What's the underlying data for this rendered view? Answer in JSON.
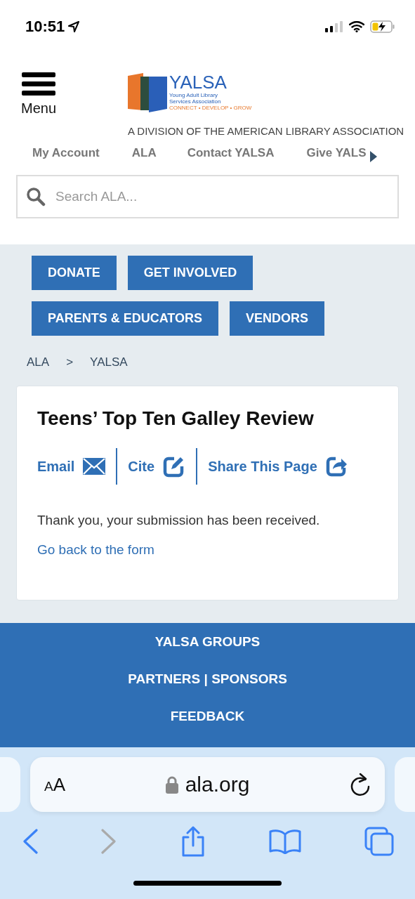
{
  "status_bar": {
    "time": "10:51"
  },
  "header": {
    "menu_label": "Menu",
    "logo": {
      "name": "YALSA",
      "subtitle": "Young Adult Library Services Association",
      "tagline": "CONNECT • DEVELOP • GROW"
    },
    "division": "A DIVISION OF THE AMERICAN LIBRARY ASSOCIATION",
    "nav": [
      "My Account",
      "ALA",
      "Contact YALSA",
      "Give YALS"
    ],
    "search": {
      "placeholder": "Search ALA..."
    }
  },
  "action_buttons": [
    "DONATE",
    "GET INVOLVED",
    "PARENTS & EDUCATORS",
    "VENDORS"
  ],
  "breadcrumb": {
    "items": [
      "ALA",
      "YALSA"
    ],
    "separator": ">"
  },
  "card": {
    "title": "Teens’ Top Ten Galley Review",
    "tools": [
      {
        "label": "Email",
        "kind": "email"
      },
      {
        "label": "Cite",
        "kind": "cite"
      },
      {
        "label": "Share This Page",
        "kind": "share"
      }
    ],
    "message": "Thank you, your submission has been received.",
    "link": "Go back to the form"
  },
  "footer_links": [
    "YALSA GROUPS",
    "PARTNERS | SPONSORS",
    "FEEDBACK"
  ],
  "browser": {
    "text_size": "AA",
    "url": "ala.org"
  }
}
